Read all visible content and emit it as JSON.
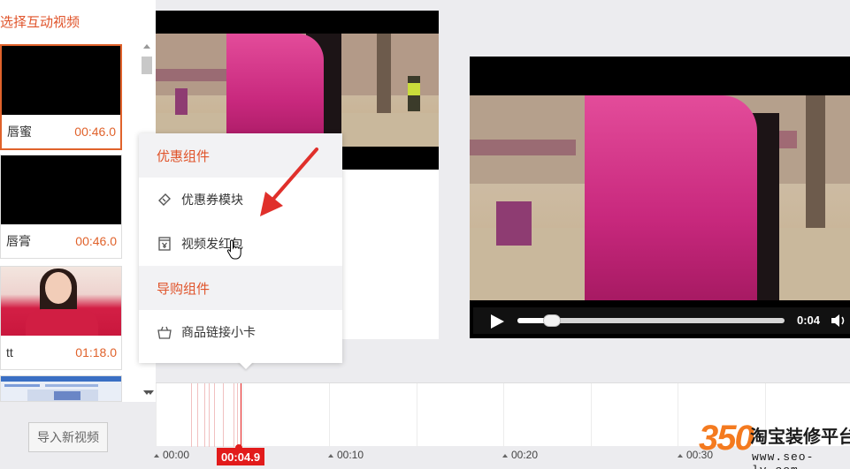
{
  "left_panel": {
    "header": "选择互动视频",
    "videos": [
      {
        "name": "唇蜜",
        "duration": "00:46.0",
        "thumb": "black",
        "selected": true
      },
      {
        "name": "唇膏",
        "duration": "00:46.0",
        "thumb": "black",
        "selected": false
      },
      {
        "name": "tt",
        "duration": "01:18.0",
        "thumb": "person",
        "selected": false
      },
      {
        "name": "",
        "duration": "",
        "thumb": "screenshot",
        "selected": false
      }
    ],
    "import_button": "导入新视频"
  },
  "popup": {
    "section1": "优惠组件",
    "coupon_item": "优惠券模块",
    "redpacket_item": "视频发红包",
    "section2": "导购组件",
    "product_item": "商品链接小卡"
  },
  "player": {
    "time": "0:04",
    "progress_fraction": 0.13
  },
  "timeline": {
    "current_time": "00:04.9",
    "ruler_labels": [
      "00:00",
      "00:10",
      "00:20",
      "00:30"
    ]
  },
  "watermark": {
    "number": "350",
    "brand": "淘宝装修平台",
    "url": "www.seo-lv.com"
  },
  "colors": {
    "accent": "#e0542b",
    "playhead": "#e21b1b",
    "watermark_orange": "#f47a1f"
  },
  "icons": {
    "coupon": "ticket-icon",
    "redpacket": "red-packet-icon",
    "product": "shopping-bag-icon",
    "play": "play-icon",
    "volume": "volume-icon"
  }
}
